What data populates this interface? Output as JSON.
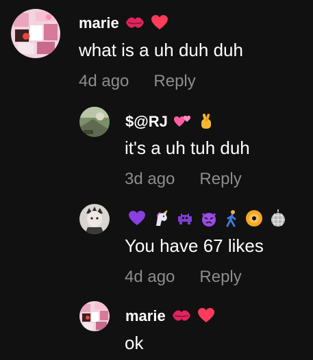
{
  "comments": [
    {
      "username": "marie",
      "text": "what is a uh duh duh",
      "time": "4d ago",
      "reply": "Reply",
      "badges": [
        "kiss-mark-icon",
        "heart-icon"
      ]
    },
    {
      "username": "$@RJ",
      "text": "it's a uh tuh duh",
      "time": "3d ago",
      "reply": "Reply",
      "badges": [
        "two-hearts-icon",
        "crossed-fingers-icon"
      ]
    },
    {
      "username": "",
      "text": "You have 67 likes",
      "time": "4d ago",
      "reply": "Reply",
      "badges": [
        "purple-heart-icon",
        "unicorn-icon",
        "alien-monster-icon",
        "angry-devil-icon",
        "person-walking-icon",
        "dvd-icon",
        "disco-ball-icon"
      ]
    },
    {
      "username": "marie",
      "text": "ok",
      "badges": [
        "kiss-mark-icon",
        "heart-icon"
      ]
    }
  ],
  "colors": {
    "background": "#111111",
    "primary_text": "#ffffff",
    "secondary_text": "#8d8d8d",
    "heart": "#ff3b5c"
  }
}
